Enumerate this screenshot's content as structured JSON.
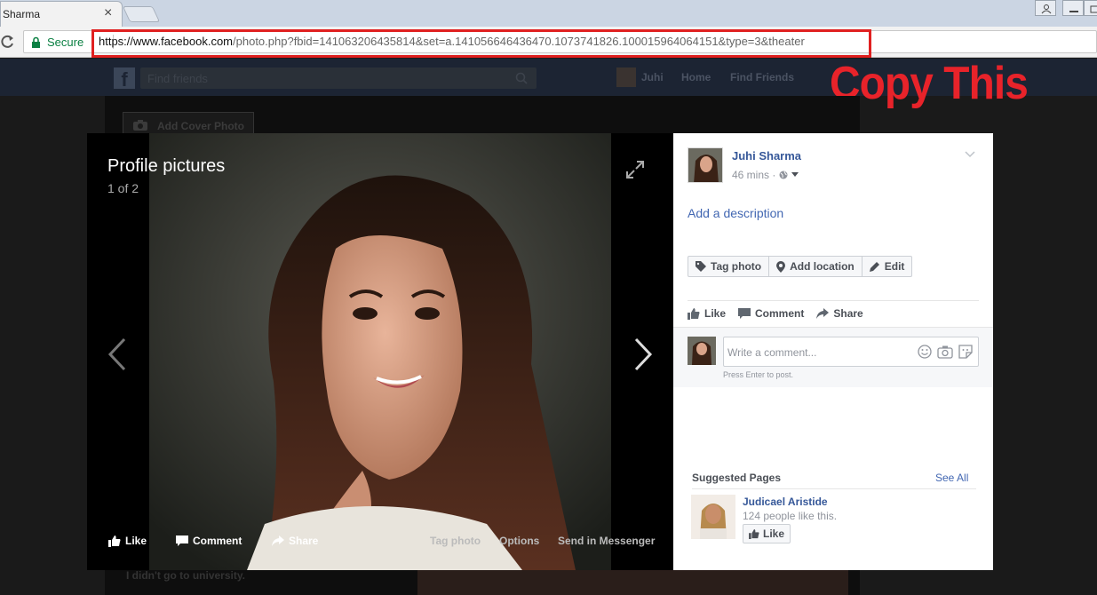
{
  "browser": {
    "tab_title": "Sharma",
    "tab_close": "×",
    "secure_label": "Secure",
    "url_host": "https://www.facebook.com",
    "url_rest": "/photo.php?fbid=141063206435814&set=a.141056646436470.1073741826.100015964064151&type=3&theater"
  },
  "annotation": {
    "text": "Copy This",
    "color": "#e8232a"
  },
  "facebook": {
    "search_placeholder": "Find friends",
    "nav_user": "Juhi",
    "nav_home": "Home",
    "nav_find_friends": "Find Friends",
    "add_cover_photo": "Add Cover Photo",
    "bio_snippet": "I didn't go to university."
  },
  "viewer": {
    "album_title": "Profile pictures",
    "position": "1 of 2",
    "actions": {
      "like": "Like",
      "comment": "Comment",
      "share": "Share",
      "tag_photo": "Tag photo",
      "options": "Options",
      "send_messenger": "Send in Messenger"
    }
  },
  "panel": {
    "author": "Juhi Sharma",
    "time": "46 mins ·",
    "add_description": "Add a description",
    "buttons": {
      "tag_photo": "Tag photo",
      "add_location": "Add location",
      "edit": "Edit"
    },
    "actions": {
      "like": "Like",
      "comment": "Comment",
      "share": "Share"
    },
    "comment_placeholder": "Write a comment...",
    "comment_hint": "Press Enter to post.",
    "suggested": {
      "title": "Suggested Pages",
      "see_all": "See All",
      "page_name": "Judicael Aristide",
      "page_likes": "124 people like this.",
      "like_button": "Like"
    }
  },
  "colors": {
    "fb_blue": "#365899",
    "link_blue": "#4267b2",
    "secure_green": "#0b8043"
  }
}
